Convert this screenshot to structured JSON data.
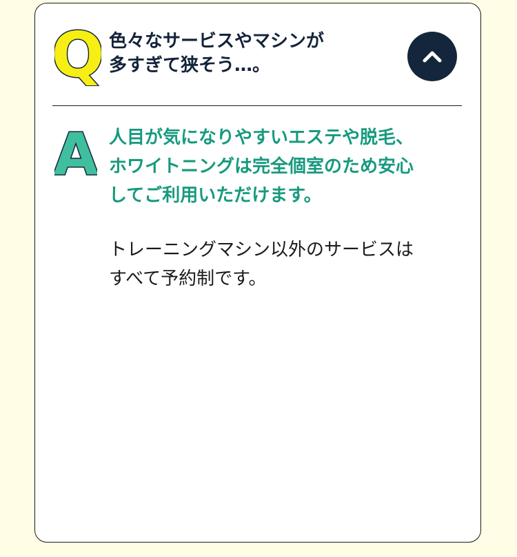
{
  "faq": {
    "question_mark": "Q",
    "question": "色々なサービスやマシンが\n多すぎて狭そう…。",
    "answer_mark": "A",
    "answer_highlight": "人目が気になりやすいエステや脱毛、\nホワイトニングは完全個室のため安心\nしてご利用いただけます。",
    "answer_body": "トレーニングマシン以外のサービスは\nすべて予約制です。",
    "toggle_icon": "chevron-up-icon",
    "expanded": true
  },
  "colors": {
    "page_background": "#fffde6",
    "card_background": "#ffffff",
    "question_mark_fill": "#f7ef14",
    "answer_mark_fill": "#3fbf9e",
    "mark_outline": "#14263b",
    "question_text": "#14233a",
    "answer_highlight_text": "#179a7e",
    "answer_body_text": "#1a1a1a",
    "toggle_background": "#14263b",
    "toggle_icon": "#ffffff"
  }
}
